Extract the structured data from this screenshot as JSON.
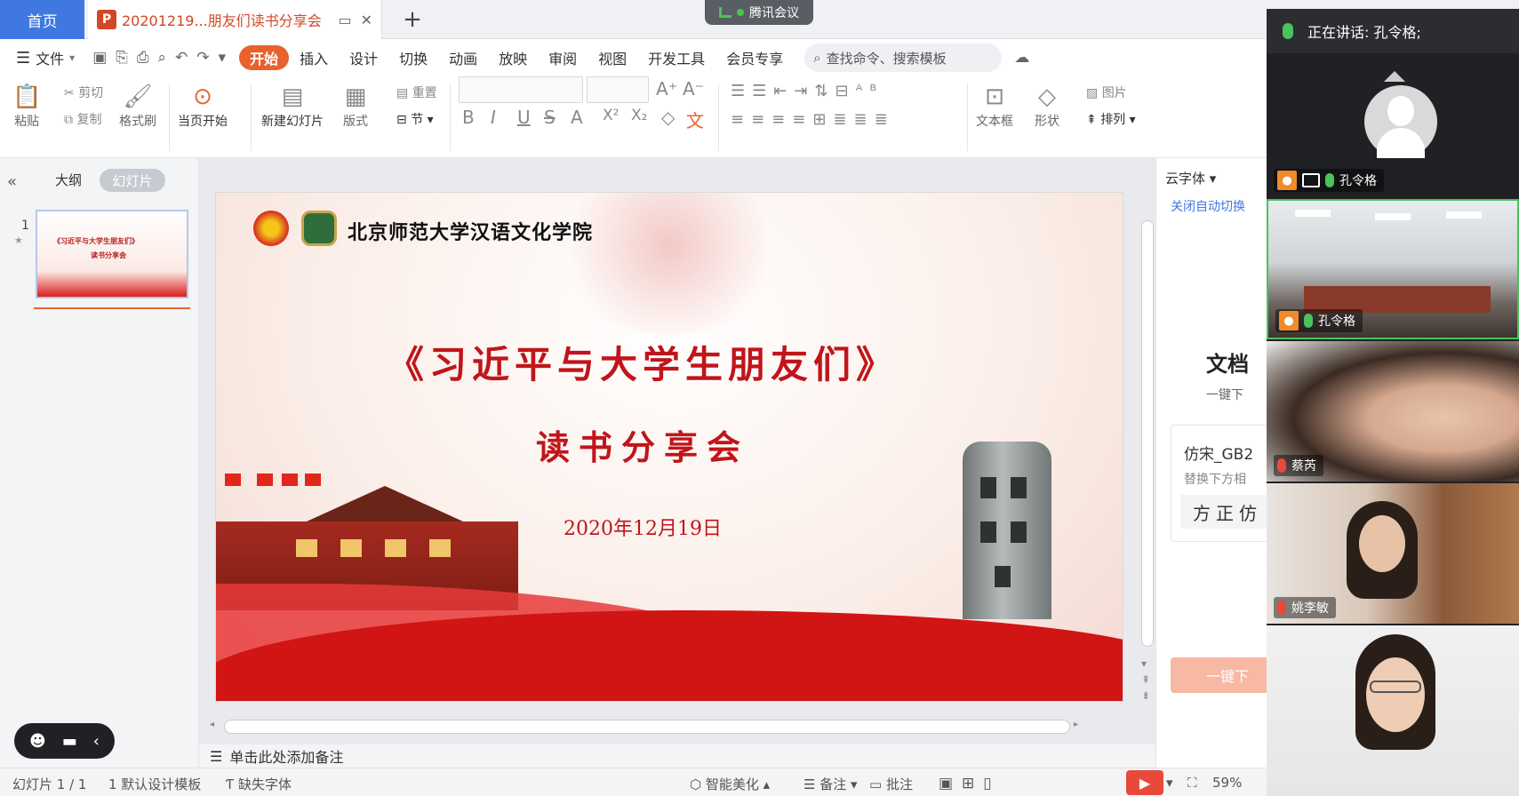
{
  "tabs": {
    "home": "首页",
    "document": "20201219...朋友们读书分享会"
  },
  "meeting_app": {
    "name": "腾讯会议"
  },
  "menu": {
    "file": "文件",
    "items": [
      "开始",
      "插入",
      "设计",
      "切换",
      "动画",
      "放映",
      "审阅",
      "视图",
      "开发工具",
      "会员专享"
    ],
    "search_placeholder": "查找命令、搜索模板"
  },
  "toolbar": {
    "paste": "粘贴",
    "cut": "剪切",
    "copy": "复制",
    "format_painter": "格式刷",
    "play_from_current": "当页开始",
    "new_slide": "新建幻灯片",
    "layout": "版式",
    "reset": "重置",
    "section": "节",
    "textbox": "文本框",
    "shape": "形状",
    "picture": "图片",
    "arrange": "排列",
    "font_grow": "A⁺",
    "font_shrink": "A⁻",
    "bold": "B",
    "italic": "I",
    "underline": "U",
    "strike": "S",
    "font_color": "A",
    "superscript": "X²",
    "subscript": "X₂",
    "clear": "◇",
    "phonetic": "文"
  },
  "left_panel": {
    "outline_tab": "大纲",
    "slides_tab": "幻灯片",
    "slide_number": "1",
    "thumb_title": "《习近平与大学生朋友们》",
    "thumb_subtitle": "读书分享会"
  },
  "slide": {
    "college": "北京师范大学汉语文化学院",
    "title": "《习近平与大学生朋友们》",
    "subtitle": "读书分享会",
    "date": "2020年12月19日"
  },
  "notes": {
    "placeholder": "单击此处添加备注"
  },
  "right_panel": {
    "cloud_font": "云字体",
    "auto_switch": "关闭自动切换",
    "doc_title": "文档",
    "doc_sub": "一键下",
    "font_name": "仿宋_GB2",
    "font_sub": "替换下方相",
    "font_sample": "方正仿",
    "download_btn": "一键下"
  },
  "status": {
    "slide_counter": "幻灯片 1 / 1",
    "template": "1 默认设计模板",
    "missing_fonts": "缺失字体",
    "smart_beautify": "智能美化",
    "notes": "备注",
    "comments": "批注",
    "zoom": "59%"
  },
  "meeting": {
    "speaking_label": "正在讲话: 孔令格;",
    "participants": [
      {
        "name": "孔令格"
      },
      {
        "name": "孔令格"
      },
      {
        "name": "蔡芮"
      },
      {
        "name": "姚李敏"
      },
      {
        "name": ""
      }
    ]
  },
  "colors": {
    "accent": "#e8622e",
    "tab_blue": "#3f78e0",
    "slide_red": "#c0151a"
  }
}
